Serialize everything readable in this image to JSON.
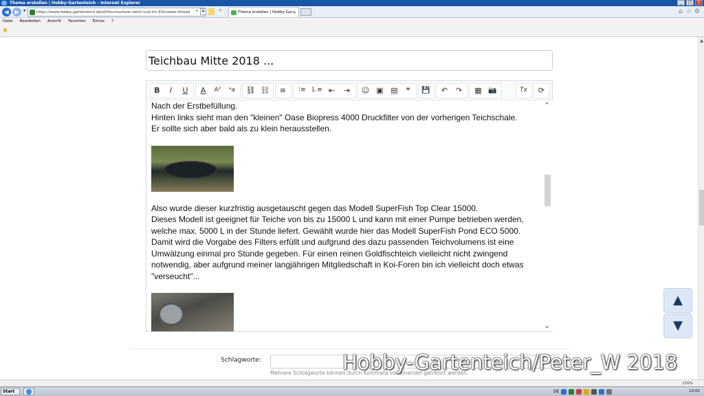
{
  "window": {
    "title": "Thema erstellen | Hobby-Gartenteich - Internet Explorer",
    "controls": [
      "_",
      "□",
      "x"
    ]
  },
  "browser": {
    "url": "https://www.hobby-gartenteich.de/xf/forums/mein-teich-und-ich.63/create-thread",
    "tab_label": "Thema erstellen | Hobby-Gar...",
    "tab_close": "×"
  },
  "menu": [
    "Datei",
    "Bearbeiten",
    "Ansicht",
    "Favoriten",
    "Extras",
    "?"
  ],
  "form": {
    "title_value": "Teichbau Mitte 2018 ...",
    "tags_label": "Schlagworte:",
    "tags_value": "",
    "tags_hint": "Mehrere Schlagworte können durch Kommata voneinander getrennt werden."
  },
  "editor": {
    "toolbar": [
      {
        "name": "bold",
        "glyph": "B"
      },
      {
        "name": "italic",
        "glyph": "I"
      },
      {
        "name": "underline",
        "glyph": "U"
      },
      {
        "name": "font-color",
        "glyph": "A"
      },
      {
        "name": "font-size",
        "glyph": "A²"
      },
      {
        "name": "font-family",
        "glyph": "ᵃa"
      },
      {
        "name": "insert-link",
        "glyph": "⛓"
      },
      {
        "name": "remove-link",
        "glyph": "⛓"
      },
      {
        "name": "align",
        "glyph": "≡"
      },
      {
        "name": "bullet-list",
        "glyph": "⁝≡"
      },
      {
        "name": "numbered-list",
        "glyph": "⒈≡"
      },
      {
        "name": "outdent",
        "glyph": "⇤"
      },
      {
        "name": "indent",
        "glyph": "⇥"
      },
      {
        "name": "smilies",
        "glyph": "☺"
      },
      {
        "name": "insert-image",
        "glyph": "▣"
      },
      {
        "name": "media",
        "glyph": "▤"
      },
      {
        "name": "quote",
        "glyph": "❝"
      },
      {
        "name": "save-draft",
        "glyph": "💾"
      },
      {
        "name": "undo",
        "glyph": "↶"
      },
      {
        "name": "redo",
        "glyph": "↷"
      },
      {
        "name": "bbcode",
        "glyph": "▦"
      },
      {
        "name": "camera",
        "glyph": "📷"
      },
      {
        "name": "remove-format",
        "glyph": "Tx"
      },
      {
        "name": "toggle-bbcode",
        "glyph": "⟳"
      }
    ],
    "paragraph1": [
      "Nach der Erstbefüllung.",
      "Hinten links sieht man den \"kleinen\" Oase Biopress 4000 Druckfilter von der vorherigen Teichschale.",
      "Er sollte sich aber bald als zu klein herausstellen."
    ],
    "paragraph2": [
      "Also wurde dieser kurzfristig ausgetauscht gegen das Modell SuperFish Top Clear 15000.",
      "Dieses Modell ist geeignet für Teiche von bis zu 15000 L und kann mit einer Pumpe betrieben werden,",
      "welche max. 5000 L in der Stunde liefert. Gewählt wurde hier das Modell SuperFish Pond ECO 5000.",
      "Damit wird die Vorgabe des Filters erfüllt und aufgrund des dazu passenden Teichvolumens ist eine",
      "Umwälzung einmal pro Stunde gegeben. Für einen reinen Goldfischteich vielleicht nicht zwingend",
      "notwendig, aber aufgrund meiner langjährigen Mitgliedschaft in Koi-Foren bin ich vielleicht doch etwas",
      "\"verseucht\"..."
    ]
  },
  "scroll_buttons": {
    "up": "▲",
    "down": "▼"
  },
  "watermark": "Hobby-Gartenteich/Peter_W 2018",
  "statusbar": {
    "zoom": "150%"
  },
  "taskbar": {
    "start": "Start",
    "lang": "DE",
    "clock": "13:02"
  }
}
